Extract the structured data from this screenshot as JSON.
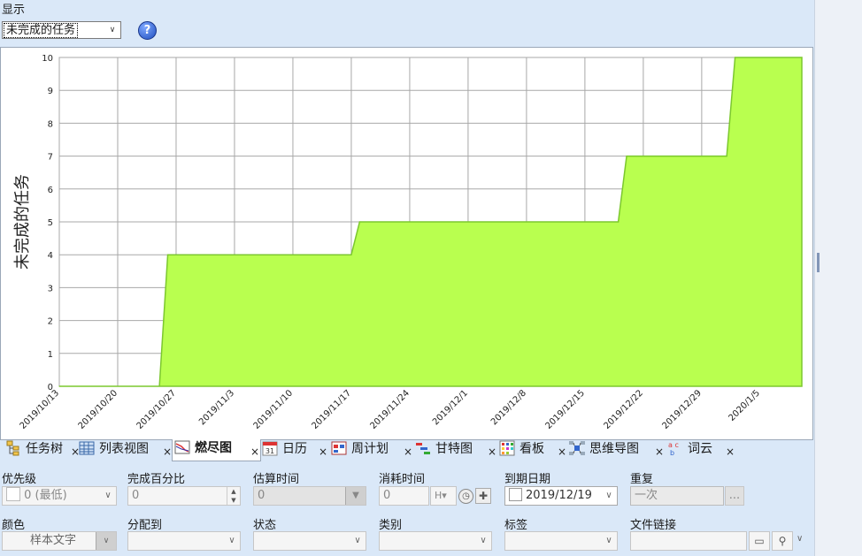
{
  "header": {
    "show_label": "显示",
    "filter_selected": "未完成的任务",
    "help_icon": "?"
  },
  "chart_data": {
    "type": "area",
    "ylabel": "未完成的任务",
    "ylim": [
      0,
      10
    ],
    "yticks": [
      "0",
      "1",
      "2",
      "3",
      "4",
      "5",
      "6",
      "7",
      "8",
      "9",
      "10"
    ],
    "xticks": [
      "2019/10/13",
      "2019/10/20",
      "2019/10/27",
      "2019/11/3",
      "2019/11/10",
      "2019/11/17",
      "2019/11/24",
      "2019/12/1",
      "2019/12/8",
      "2019/12/15",
      "2019/12/22",
      "2019/12/29",
      "2020/1/5"
    ],
    "xlim": [
      "2019/10/13",
      "2020/1/10"
    ],
    "series": [
      {
        "color": "#b9ff4f",
        "line_color": "#7cc82e",
        "points": [
          {
            "x": "2019/10/13",
            "y": 0
          },
          {
            "x": "2019/10/25",
            "y": 0
          },
          {
            "x": "2019/10/26",
            "y": 4
          },
          {
            "x": "2019/11/17",
            "y": 4
          },
          {
            "x": "2019/11/18",
            "y": 5
          },
          {
            "x": "2019/12/19",
            "y": 5
          },
          {
            "x": "2019/12/20",
            "y": 7
          },
          {
            "x": "2020/1/1",
            "y": 7
          },
          {
            "x": "2020/1/2",
            "y": 10
          },
          {
            "x": "2020/1/10",
            "y": 10
          }
        ]
      }
    ],
    "grid": true
  },
  "tabs": [
    {
      "label": "任务树",
      "icon": "task-tree-icon"
    },
    {
      "label": "列表视图",
      "icon": "list-view-icon"
    },
    {
      "label": "燃尽图",
      "icon": "burndown-icon"
    },
    {
      "label": "日历",
      "icon": "calendar-icon",
      "icon_text": "31"
    },
    {
      "label": "周计划",
      "icon": "week-plan-icon"
    },
    {
      "label": "甘特图",
      "icon": "gantt-icon"
    },
    {
      "label": "看板",
      "icon": "kanban-icon"
    },
    {
      "label": "思维导图",
      "icon": "mindmap-icon"
    },
    {
      "label": "词云",
      "icon": "wordcloud-icon",
      "icon_text": "a c"
    }
  ],
  "close_glyph": "×",
  "fields": {
    "priority": {
      "label": "优先级",
      "value": "0 (最低)"
    },
    "percent": {
      "label": "完成百分比",
      "value": "0"
    },
    "estimate": {
      "label": "估算时间",
      "value": "0"
    },
    "spent": {
      "label": "消耗时间",
      "value": "0",
      "unit": "H"
    },
    "due": {
      "label": "到期日期",
      "value": "2019/12/19"
    },
    "recurrence": {
      "label": "重复",
      "value": "一次",
      "button": "..."
    },
    "color": {
      "label": "颜色",
      "value": "样本文字"
    },
    "assigned": {
      "label": "分配到",
      "value": ""
    },
    "status": {
      "label": "状态",
      "value": ""
    },
    "category": {
      "label": "类别",
      "value": ""
    },
    "tags": {
      "label": "标签",
      "value": ""
    },
    "filelink": {
      "label": "文件链接",
      "value": ""
    }
  }
}
